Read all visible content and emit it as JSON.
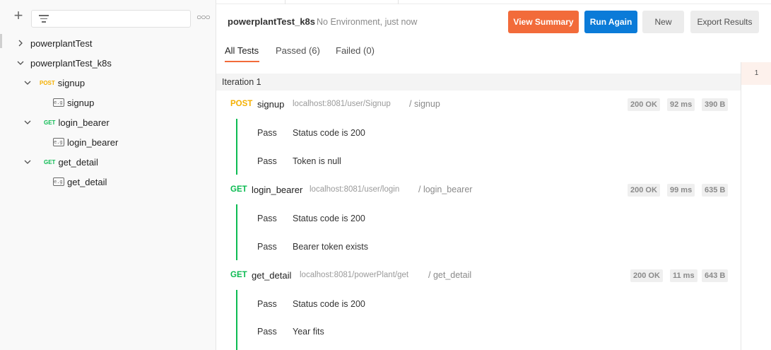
{
  "sidebar": {
    "add_icon": "plus-icon",
    "filter_icon": "filter-icon",
    "more_icon": "more-horizontal-icon",
    "tree": [
      {
        "label": "powerplantTest",
        "type": "folder",
        "expanded": false
      },
      {
        "label": "powerplantTest_k8s",
        "type": "folder",
        "expanded": true
      },
      {
        "label": "signup",
        "type": "request",
        "method": "POST",
        "expanded": true
      },
      {
        "label": "signup",
        "type": "example"
      },
      {
        "label": "login_bearer",
        "type": "request",
        "method": "GET",
        "expanded": true
      },
      {
        "label": "login_bearer",
        "type": "example"
      },
      {
        "label": "get_detail",
        "type": "request",
        "method": "GET",
        "expanded": true
      },
      {
        "label": "get_detail",
        "type": "example"
      }
    ]
  },
  "header": {
    "title": "powerplantTest_k8s",
    "subtitle": "No Environment, just now",
    "buttons": {
      "summary": "View Summary",
      "run_again": "Run Again",
      "new": "New",
      "export": "Export Results"
    }
  },
  "tabs": [
    {
      "label": "All Tests",
      "active": true
    },
    {
      "label": "Passed (6)",
      "active": false
    },
    {
      "label": "Failed (0)",
      "active": false
    }
  ],
  "iteration": {
    "label": "Iteration 1",
    "number": "1"
  },
  "requests": [
    {
      "method": "POST",
      "name": "signup",
      "url": "localhost:8081/user/Signup",
      "path": "/ signup",
      "status": "200 OK",
      "time": "92 ms",
      "size": "390 B",
      "tests": [
        {
          "status": "Pass",
          "name": "Status code is 200"
        },
        {
          "status": "Pass",
          "name": "Token is null"
        }
      ]
    },
    {
      "method": "GET",
      "name": "login_bearer",
      "url": "localhost:8081/user/login",
      "path": "/ login_bearer",
      "status": "200 OK",
      "time": "99 ms",
      "size": "635 B",
      "tests": [
        {
          "status": "Pass",
          "name": "Status code is 200"
        },
        {
          "status": "Pass",
          "name": "Bearer token exists"
        }
      ]
    },
    {
      "method": "GET",
      "name": "get_detail",
      "url": "localhost:8081/powerPlant/get",
      "path": "/ get_detail",
      "status": "200 OK",
      "time": "11 ms",
      "size": "643 B",
      "tests": [
        {
          "status": "Pass",
          "name": "Status code is 200"
        },
        {
          "status": "Pass",
          "name": "Year fits"
        }
      ]
    }
  ],
  "colors": {
    "accent": "#f26b3a",
    "primary": "#0b7bd8",
    "post": "#f5b000",
    "get": "#0cbb52",
    "pass_bar": "#0cbb52"
  }
}
